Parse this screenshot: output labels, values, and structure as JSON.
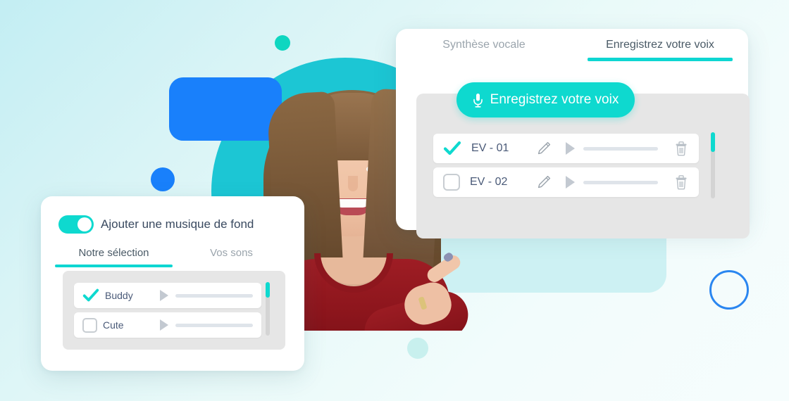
{
  "background": {
    "gradient_from": "#c3eef3",
    "gradient_to": "#f6fdfd",
    "shapes": {
      "teal_blob_color": "#1cc6d4",
      "teal_soft_rect_color": "#cdf1f3",
      "blue_rect_color": "#1980fb",
      "blue_dot_color": "#1980fb",
      "teal_dot_color": "#0ed6c0",
      "mint_dot_color": "#c8f0ee",
      "blue_ring_color": "#2a86f0"
    }
  },
  "theme": {
    "accent": "#0ed9cf",
    "accent_underline": "#0ed6d2",
    "text_dark": "#4a5a78",
    "text_muted": "#9aa4ac",
    "panel_bg": "#ffffff",
    "inner_bg": "#e6e6e6"
  },
  "voice_panel": {
    "tabs": [
      {
        "label": "Synthèse vocale",
        "active": false
      },
      {
        "label": "Enregistrez votre voix",
        "active": true
      }
    ],
    "record_button": {
      "label": "Enregistrez votre voix",
      "icon": "microphone-icon"
    },
    "recordings": [
      {
        "label": "EV - 01",
        "selected": true,
        "actions": [
          "edit-icon",
          "play-icon",
          "progress-bar",
          "delete-icon"
        ]
      },
      {
        "label": "EV - 02",
        "selected": false,
        "actions": [
          "edit-icon",
          "play-icon",
          "progress-bar",
          "delete-icon"
        ]
      }
    ],
    "scrollbar": {
      "position": "top"
    }
  },
  "music_panel": {
    "toggle": {
      "label": "Ajouter une musique de fond",
      "state": "on"
    },
    "tabs": [
      {
        "label": "Notre sélection",
        "active": true
      },
      {
        "label": "Vos sons",
        "active": false
      }
    ],
    "tracks": [
      {
        "label": "Buddy",
        "selected": true,
        "actions": [
          "play-icon",
          "progress-bar"
        ]
      },
      {
        "label": "Cute",
        "selected": false,
        "actions": [
          "play-icon",
          "progress-bar"
        ]
      }
    ],
    "scrollbar": {
      "position": "top"
    }
  },
  "photo": {
    "alt": "smiling woman in red sweater pointing"
  }
}
